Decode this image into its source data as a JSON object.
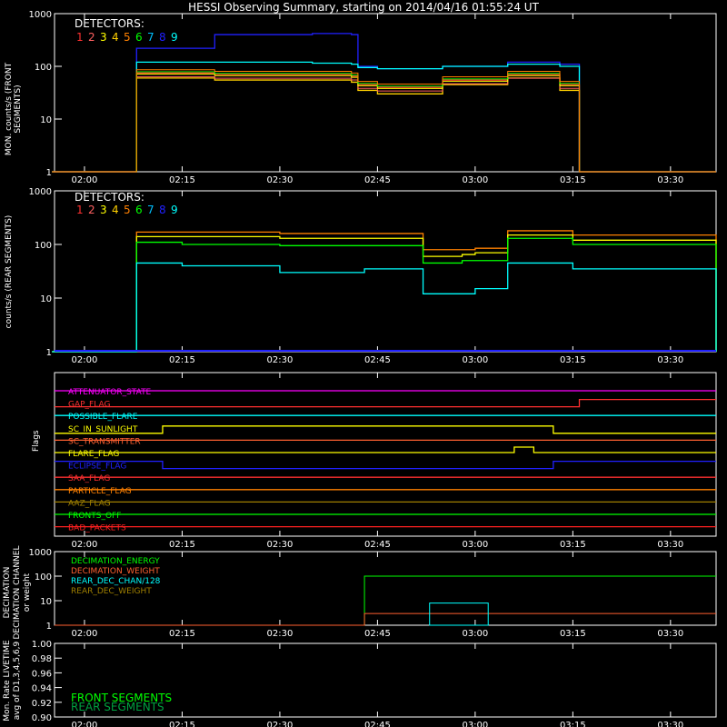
{
  "title": "HESSI Observing Summary, starting on 2014/04/16 01:55:24 UT",
  "colors": {
    "bg": "#000000",
    "axis": "#ffffff",
    "det": [
      "#ff3030",
      "#ff6060",
      "#ffff00",
      "#ffd000",
      "#ff8000",
      "#00ff00",
      "#00c0ff",
      "#2020ff",
      "#00ffff"
    ]
  },
  "time_ticks": [
    "02:00",
    "02:15",
    "02:30",
    "02:45",
    "03:00",
    "03:15",
    "03:30"
  ],
  "chart_data": [
    {
      "type": "line",
      "ylabel": "MON. counts/s (FRONT SEGMENTS)",
      "yscale": "log",
      "ylim": [
        1,
        1000
      ],
      "y_ticks": [
        "1",
        "10",
        "100",
        "1000"
      ],
      "legend_title": "DETECTORS:",
      "legend_numbers": [
        "1",
        "2",
        "3",
        "4",
        "5",
        "6",
        "7",
        "8",
        "9"
      ],
      "x_range": [
        "01:55:24",
        "03:37:00"
      ],
      "x": [
        "01:55",
        "02:08",
        "02:20",
        "02:35",
        "02:41",
        "02:42",
        "02:45",
        "02:55",
        "03:05",
        "03:13",
        "03:16",
        "03:37"
      ],
      "series": [
        {
          "values": [
            1,
            220,
            400,
            420,
            400,
            100,
            90,
            100,
            120,
            110,
            1,
            1
          ]
        },
        {
          "values": [
            1,
            120,
            120,
            115,
            110,
            95,
            90,
            100,
            110,
            100,
            1,
            1
          ]
        },
        {
          "values": [
            1,
            75,
            70,
            70,
            65,
            45,
            40,
            55,
            70,
            45,
            1,
            1
          ]
        },
        {
          "values": [
            1,
            60,
            55,
            55,
            50,
            35,
            30,
            45,
            60,
            35,
            1,
            1
          ]
        }
      ]
    },
    {
      "type": "line",
      "ylabel": "counts/s (REAR SEGMENTS)",
      "yscale": "log",
      "ylim": [
        1,
        1000
      ],
      "y_ticks": [
        "1",
        "10",
        "100",
        "1000"
      ],
      "legend_title": "DETECTORS:",
      "legend_numbers": [
        "1",
        "2",
        "3",
        "4",
        "5",
        "6",
        "7",
        "8",
        "9"
      ],
      "x": [
        "01:55",
        "02:08",
        "02:15",
        "02:30",
        "02:43",
        "02:52",
        "02:58",
        "03:00",
        "03:05",
        "03:15",
        "03:37"
      ],
      "series": [
        {
          "values": [
            1,
            170,
            170,
            160,
            160,
            80,
            80,
            85,
            180,
            150,
            1
          ]
        },
        {
          "values": [
            1,
            140,
            140,
            130,
            130,
            60,
            65,
            70,
            150,
            120,
            1
          ]
        },
        {
          "values": [
            1,
            110,
            100,
            95,
            95,
            45,
            50,
            50,
            130,
            100,
            1
          ]
        },
        {
          "values": [
            1,
            45,
            40,
            30,
            35,
            12,
            12,
            15,
            45,
            35,
            1
          ]
        }
      ]
    },
    {
      "type": "flags",
      "ylabel": "Flags",
      "flags": [
        "ATTENUATOR_STATE",
        "GAP_FLAG",
        "POSSIBLE_FLARE",
        "SC_IN_SUNLIGHT",
        "SC_TRANSMITTER",
        "FLARE_FLAG",
        "ECLIPSE_FLAG",
        "SAA_FLAG",
        "PARTICLE_FLAG",
        "AAZ_FLAG",
        "FRONTS_OFF",
        "BAD_PACKETS"
      ]
    },
    {
      "type": "line",
      "ylabel": "DECIMATION CHANNEL or weight",
      "yscale": "log",
      "ylim": [
        1,
        1000
      ],
      "y_ticks": [
        "1",
        "10",
        "100",
        "1000"
      ],
      "legend": [
        "DECIMATION_ENERGY",
        "DECIMATION_WEIGHT",
        "REAR_DEC_CHAN/128",
        "REAR_DEC_WEIGHT"
      ]
    },
    {
      "type": "line",
      "ylabel": "Mon. Rate LIVETIME avg of D1,3,4,5,6,9",
      "ylim": [
        0.9,
        1.0
      ],
      "y_ticks": [
        "1.00",
        "0.98",
        "0.96",
        "0.94",
        "0.92",
        "0.90"
      ],
      "legend": [
        "FRONT SEGMENTS",
        "REAR SEGMENTS"
      ]
    }
  ]
}
